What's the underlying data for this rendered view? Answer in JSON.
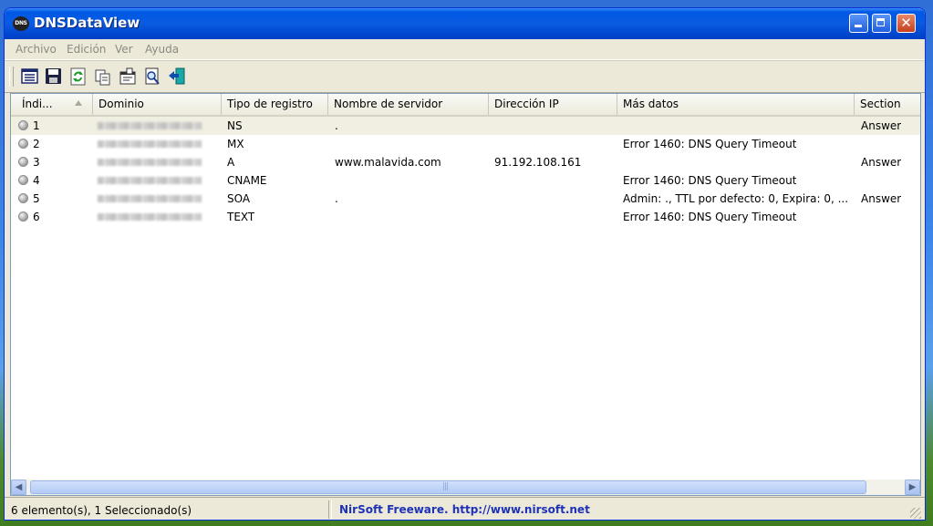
{
  "window": {
    "title": "DNSDataView",
    "icon": "DNS"
  },
  "menu": [
    "Archivo",
    "Edición",
    "Ver",
    "Ayuda"
  ],
  "toolbar_icons": [
    "html-report-icon",
    "save-icon",
    "refresh-icon",
    "copy-icon",
    "properties-icon",
    "find-icon",
    "exit-icon"
  ],
  "columns": [
    "Índi...",
    "Dominio",
    "Tipo de registro",
    "Nombre de servidor",
    "Dirección IP",
    "Más datos",
    "Section"
  ],
  "rows": [
    {
      "index": "1",
      "type": "NS",
      "server": ".",
      "ip": "",
      "more": "",
      "section": "Answer"
    },
    {
      "index": "2",
      "type": "MX",
      "server": "",
      "ip": "",
      "more": "Error 1460: DNS Query Timeout",
      "section": ""
    },
    {
      "index": "3",
      "type": "A",
      "server": "www.malavida.com",
      "ip": "91.192.108.161",
      "more": "",
      "section": "Answer"
    },
    {
      "index": "4",
      "type": "CNAME",
      "server": "",
      "ip": "",
      "more": "Error 1460: DNS Query Timeout",
      "section": ""
    },
    {
      "index": "5",
      "type": "SOA",
      "server": ".",
      "ip": "",
      "more": "Admin: ., TTL por defecto: 0, Expira: 0, ...",
      "section": "Answer"
    },
    {
      "index": "6",
      "type": "TEXT",
      "server": "",
      "ip": "",
      "more": "Error 1460: DNS Query Timeout",
      "section": ""
    }
  ],
  "status": {
    "count": "6 elemento(s), 1 Seleccionado(s)",
    "credit": "NirSoft Freeware.  http://www.nirsoft.net"
  },
  "colors": {
    "title_bar": "#0a5be0",
    "link": "#1d32b8"
  }
}
